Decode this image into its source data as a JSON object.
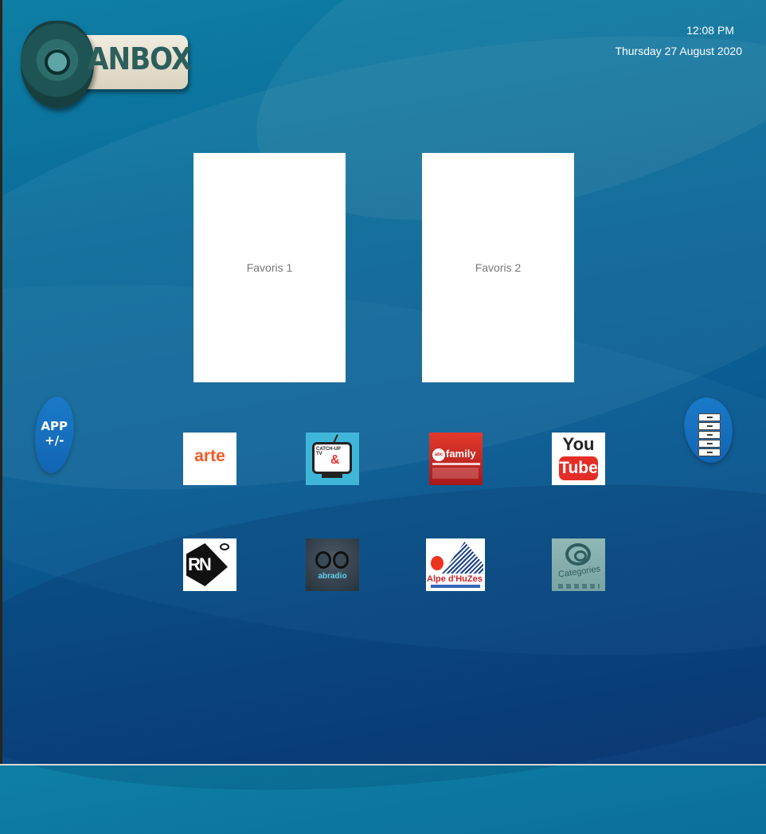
{
  "header": {
    "logo_text": "ANBOX",
    "time": "12:08 PM",
    "date": "Thursday 27 August 2020"
  },
  "favorites": [
    {
      "label": "Favoris 1"
    },
    {
      "label": "Favoris 2"
    }
  ],
  "side_buttons": {
    "left_label_line1": "APP",
    "left_label_line2": "+/-",
    "right_icon": "drawers-icon"
  },
  "apps": [
    {
      "name": "arte",
      "label": "arte"
    },
    {
      "name": "catch-up-tv",
      "label_line1": "CATCH-UP",
      "label_line2": "TV",
      "label_amp": "&"
    },
    {
      "name": "abc-family",
      "label_badge": "abc",
      "label": "family"
    },
    {
      "name": "youtube",
      "label_you": "You",
      "label_tube": "Tube"
    },
    {
      "name": "rn",
      "label": "RN"
    },
    {
      "name": "abradio",
      "label": "abradio"
    },
    {
      "name": "alpe-dhuzes",
      "label": "Alpe d'HuZes"
    },
    {
      "name": "categories",
      "label": "Categories"
    }
  ],
  "colors": {
    "background_top": "#0e7fa4",
    "background_bottom": "#0d3d7a",
    "blob": "#1a7ac8",
    "arte_orange": "#ef5a24",
    "youtube_red": "#e52d27"
  }
}
